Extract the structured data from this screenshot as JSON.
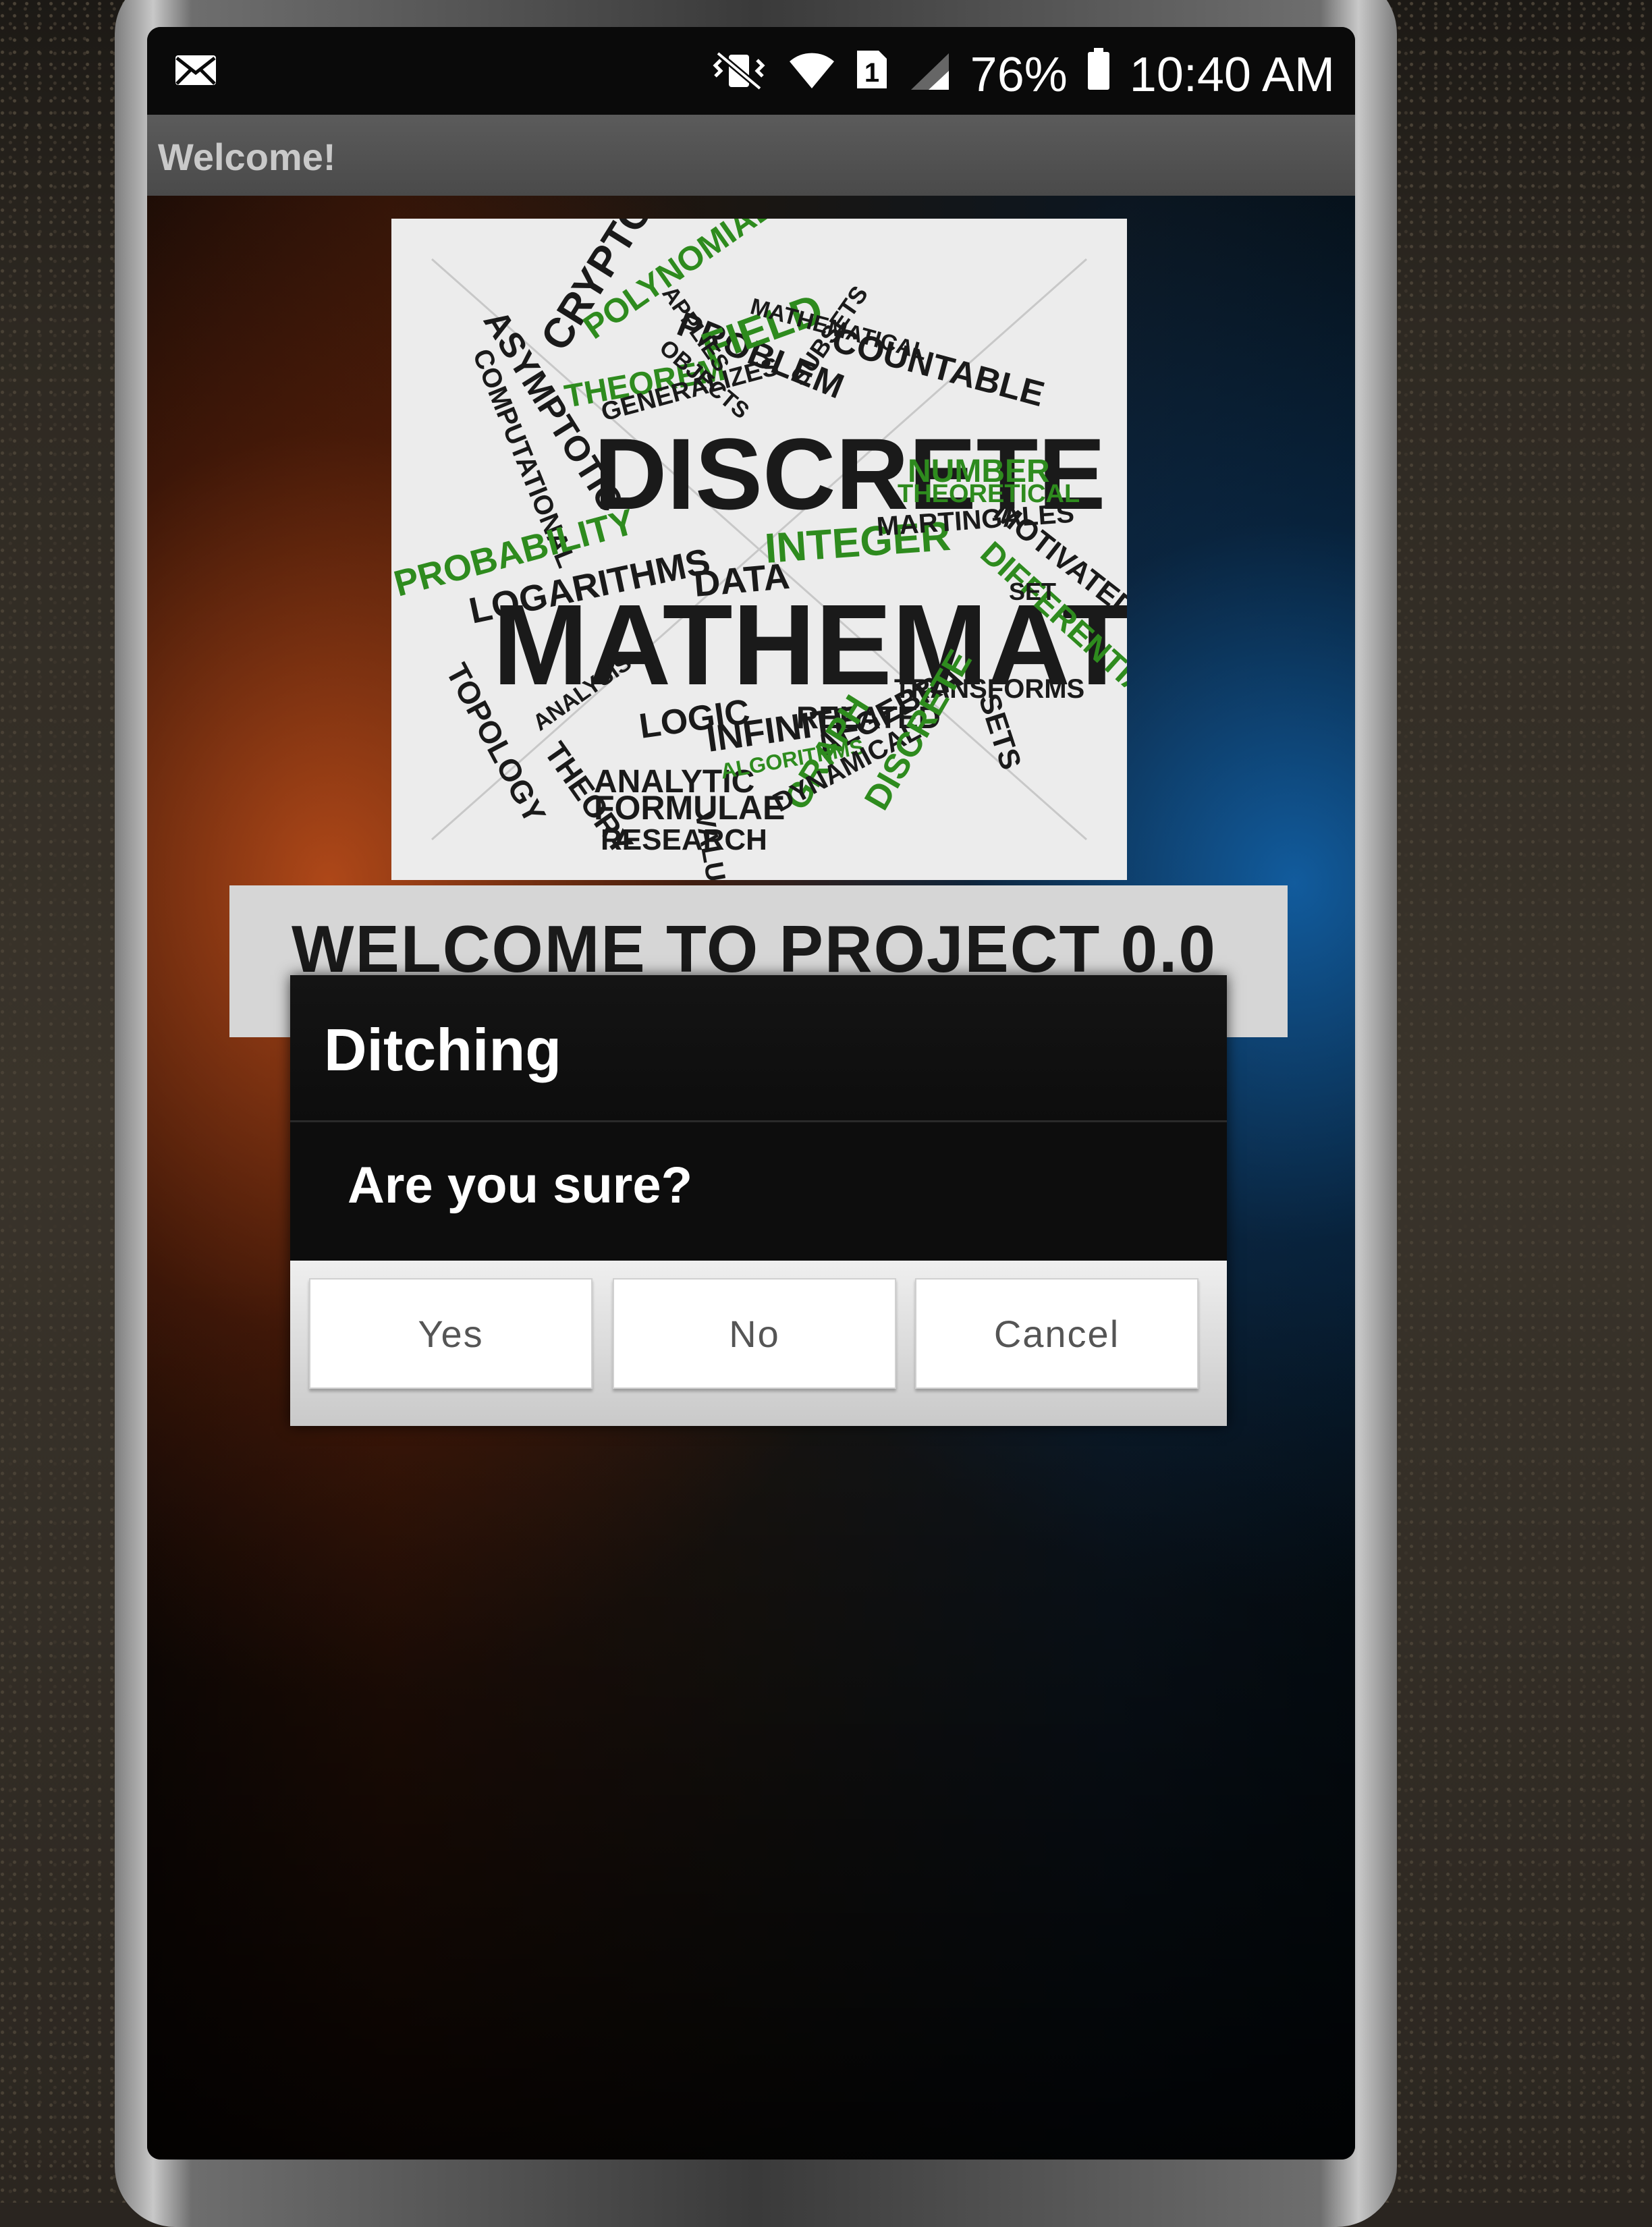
{
  "status_bar": {
    "battery": "76%",
    "time": "10:40 AM",
    "sim": "1"
  },
  "action_bar": {
    "title": "Welcome!"
  },
  "welcome_banner": {
    "text": "WELCOME TO PROJECT 0.0"
  },
  "word_cloud": {
    "words": [
      "DISCRETE",
      "MATHEMATICS",
      "CRYPTOGRAPHY",
      "POLYNOMIALS",
      "PROBLEM",
      "ASYMPTOTIC",
      "COMPUTATIONAL",
      "THEOREM",
      "FIELD",
      "COUNTABLE",
      "NUMBER",
      "THEORETICAL",
      "INTEGER",
      "MARTINGALES",
      "MOTIVATED",
      "DIFFERENTIAL",
      "PROBABILITY",
      "LOGARITHMS",
      "DATA",
      "TOPOLOGY",
      "LOGIC",
      "INFINITE",
      "RELATED",
      "TRANSFORMS",
      "SETS",
      "ALGEBRA",
      "ANALYTIC",
      "FORMULAE",
      "RESEARCH",
      "THEORY",
      "GRAPH",
      "VALUES",
      "ALGORITHMS",
      "DYNAMICAL",
      "DISCRETE",
      "SET",
      "OBJECTS",
      "SUBSETS",
      "GENERALIZES",
      "ANALYSIS",
      "MATHEMATICAL",
      "APPLIES"
    ]
  },
  "dialog": {
    "title": "Ditching",
    "message": "Are you sure?",
    "yes_label": "Yes",
    "no_label": "No",
    "cancel_label": "Cancel"
  },
  "colors": {
    "dialog_bg": "#0d0d0d",
    "button_bg": "#ffffff",
    "word_green": "#2e8b1e",
    "word_dark": "#1a1a1a"
  }
}
